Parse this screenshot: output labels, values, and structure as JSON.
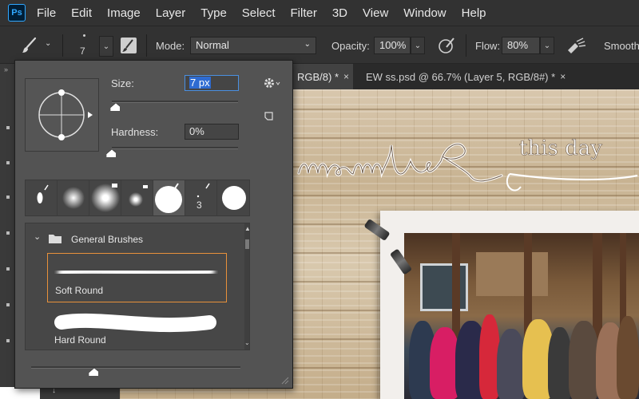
{
  "app": {
    "logo": "Ps"
  },
  "menu": [
    "File",
    "Edit",
    "Image",
    "Layer",
    "Type",
    "Select",
    "Filter",
    "3D",
    "View",
    "Window",
    "Help"
  ],
  "options": {
    "brush_size": "7",
    "mode_label": "Mode:",
    "mode_value": "Normal",
    "opacity_label": "Opacity:",
    "opacity_value": "100%",
    "flow_label": "Flow:",
    "flow_value": "80%",
    "smoothing_label": "Smooth"
  },
  "tabs": [
    {
      "label": "RGB/8) *",
      "close": "×"
    },
    {
      "label": "EW ss.psd @ 66.7% (Layer 5, RGB/8#) *",
      "close": "×"
    }
  ],
  "canvas": {
    "word_art_tail": "this day"
  },
  "picker": {
    "size_label": "Size:",
    "size_value": "7 px",
    "hardness_label": "Hardness:",
    "hardness_value": "0%",
    "recent_tip_size": "3",
    "group_name": "General Brushes",
    "brushes": [
      "Soft Round",
      "Hard Round"
    ]
  },
  "colors": {
    "menubar_bg": "#323232",
    "panel_bg": "#535353",
    "selection_accent": "#e8913b",
    "focus_accent": "#4a90e2",
    "logo_accent": "#31a8ff"
  }
}
